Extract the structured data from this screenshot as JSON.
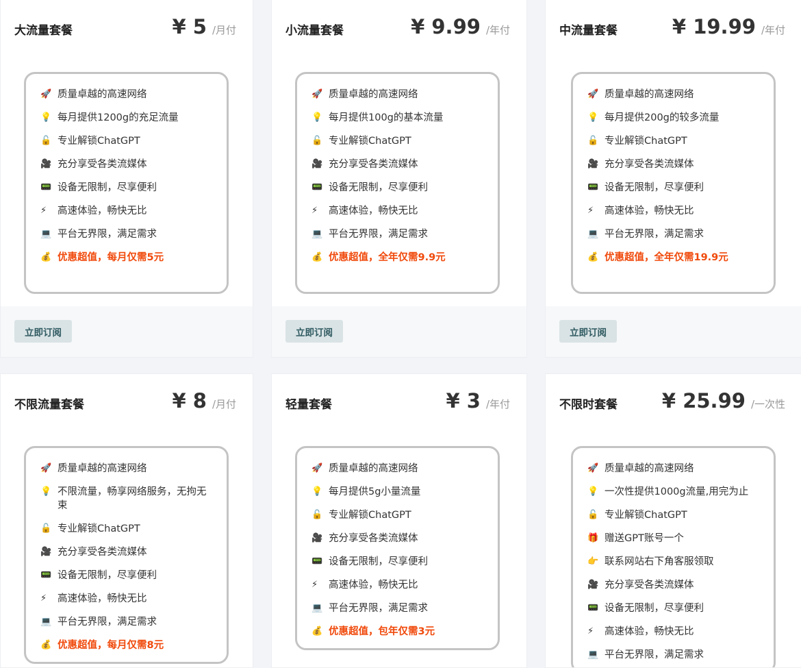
{
  "subscribe_label": "立即订阅",
  "colors": {
    "highlight": "#f04a0c",
    "button_bg": "#d9e3e5"
  },
  "plans": [
    {
      "title": "大流量套餐",
      "price": "¥ 5",
      "unit": "/月付",
      "features": [
        [
          "🚀",
          "质量卓越的高速网络"
        ],
        [
          "💡",
          "每月提供1200g的充足流量"
        ],
        [
          "🔓",
          "专业解锁ChatGPT"
        ],
        [
          "🎥",
          "充分享受各类流媒体"
        ],
        [
          "📟",
          "设备无限制，尽享便利"
        ],
        [
          "⚡",
          "高速体验，畅快无比"
        ],
        [
          "💻",
          "平台无界限，满足需求"
        ]
      ],
      "highlight": [
        "💰",
        "优惠超值，每月仅需5元"
      ]
    },
    {
      "title": "小流量套餐",
      "price": "¥ 9.99",
      "unit": "/年付",
      "features": [
        [
          "🚀",
          "质量卓越的高速网络"
        ],
        [
          "💡",
          "每月提供100g的基本流量"
        ],
        [
          "🔓",
          "专业解锁ChatGPT"
        ],
        [
          "🎥",
          "充分享受各类流媒体"
        ],
        [
          "📟",
          "设备无限制，尽享便利"
        ],
        [
          "⚡",
          "高速体验，畅快无比"
        ],
        [
          "💻",
          "平台无界限，满足需求"
        ]
      ],
      "highlight": [
        "💰",
        "优惠超值，全年仅需9.9元"
      ]
    },
    {
      "title": "中流量套餐",
      "price": "¥ 19.99",
      "unit": "/年付",
      "features": [
        [
          "🚀",
          "质量卓越的高速网络"
        ],
        [
          "💡",
          "每月提供200g的较多流量"
        ],
        [
          "🔓",
          "专业解锁ChatGPT"
        ],
        [
          "🎥",
          "充分享受各类流媒体"
        ],
        [
          "📟",
          "设备无限制，尽享便利"
        ],
        [
          "⚡",
          "高速体验，畅快无比"
        ],
        [
          "💻",
          "平台无界限，满足需求"
        ]
      ],
      "highlight": [
        "💰",
        "优惠超值，全年仅需19.9元"
      ]
    },
    {
      "title": "不限流量套餐",
      "price": "¥ 8",
      "unit": "/月付",
      "features": [
        [
          "🚀",
          "质量卓越的高速网络"
        ],
        [
          "💡",
          "不限流量，畅享网络服务，无拘无束"
        ],
        [
          "🔓",
          "专业解锁ChatGPT"
        ],
        [
          "🎥",
          "充分享受各类流媒体"
        ],
        [
          "📟",
          "设备无限制，尽享便利"
        ],
        [
          "⚡",
          "高速体验，畅快无比"
        ],
        [
          "💻",
          "平台无界限，满足需求"
        ]
      ],
      "highlight": [
        "💰",
        "优惠超值，每月仅需8元"
      ]
    },
    {
      "title": "轻量套餐",
      "price": "¥ 3",
      "unit": "/年付",
      "features": [
        [
          "🚀",
          "质量卓越的高速网络"
        ],
        [
          "💡",
          "每月提供5g小量流量"
        ],
        [
          "🔓",
          "专业解锁ChatGPT"
        ],
        [
          "🎥",
          "充分享受各类流媒体"
        ],
        [
          "📟",
          "设备无限制，尽享便利"
        ],
        [
          "⚡",
          "高速体验，畅快无比"
        ],
        [
          "💻",
          "平台无界限，满足需求"
        ]
      ],
      "highlight": [
        "💰",
        "优惠超值，包年仅需3元"
      ]
    },
    {
      "title": "不限时套餐",
      "price": "¥ 25.99",
      "unit": "/一次性",
      "features": [
        [
          "🚀",
          "质量卓越的高速网络"
        ],
        [
          "💡",
          "一次性提供1000g流量,用完为止"
        ],
        [
          "🔓",
          "专业解锁ChatGPT"
        ],
        [
          "🎁",
          "赠送GPT账号一个"
        ],
        [
          "👉",
          "联系网站右下角客服领取"
        ],
        [
          "🎥",
          "充分享受各类流媒体"
        ],
        [
          "📟",
          "设备无限制，尽享便利"
        ],
        [
          "⚡",
          "高速体验，畅快无比"
        ],
        [
          "💻",
          "平台无界限，满足需求"
        ]
      ],
      "highlight": null
    }
  ]
}
